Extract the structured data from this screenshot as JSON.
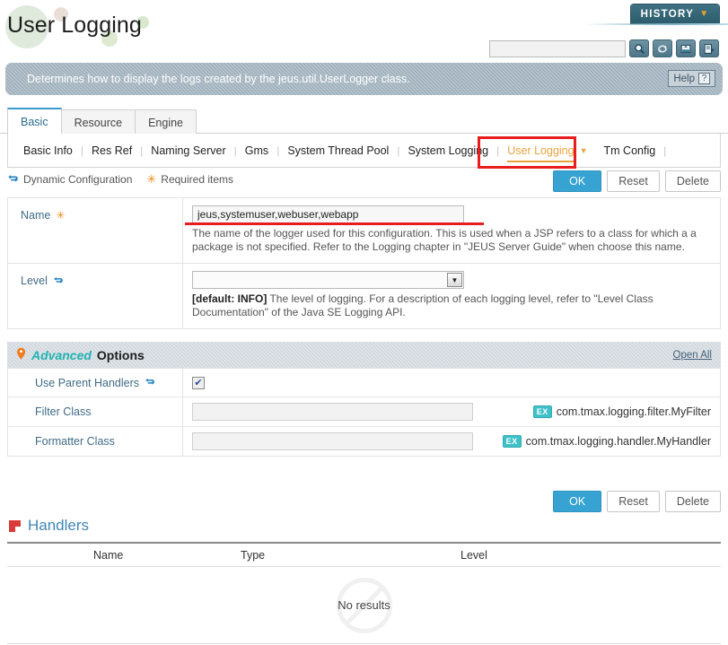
{
  "header": {
    "title": "User Logging",
    "history_label": "HISTORY",
    "history_chevron": "▼",
    "search_value": "",
    "search_placeholder": "",
    "tools": [
      {
        "name": "search-icon",
        "glyph": "🔍"
      },
      {
        "name": "refresh-icon",
        "glyph": "⟳"
      },
      {
        "name": "xml-export-icon",
        "glyph": "XML"
      },
      {
        "name": "download-icon",
        "glyph": "⬇"
      }
    ]
  },
  "banner": {
    "text": "Determines how to display the logs created by the jeus.util.UserLogger class.",
    "help_label": "Help",
    "help_glyph": "?"
  },
  "tabs": [
    {
      "label": "Basic",
      "active": true
    },
    {
      "label": "Resource",
      "active": false
    },
    {
      "label": "Engine",
      "active": false
    }
  ],
  "subtabs": [
    {
      "label": "Basic Info",
      "active": false
    },
    {
      "label": "Res Ref",
      "active": false
    },
    {
      "label": "Naming Server",
      "active": false
    },
    {
      "label": "Gms",
      "active": false
    },
    {
      "label": "System Thread Pool",
      "active": false
    },
    {
      "label": "System Logging",
      "active": false
    },
    {
      "label": "User Logging",
      "active": true
    },
    {
      "label": "Tm Config",
      "active": false
    }
  ],
  "legend": {
    "dynamic_label": "Dynamic Configuration",
    "required_label": "Required items",
    "dynamic_glyph": "↻",
    "required_glyph": "✳"
  },
  "actions": {
    "ok": "OK",
    "reset": "Reset",
    "delete": "Delete"
  },
  "form": {
    "name": {
      "label": "Name",
      "marker": "✳",
      "value": "jeus,systemuser,webuser,webapp",
      "description": "The name of the logger used for this configuration. This is used when a JSP refers to a class for which a a package is not specified. Refer to the Logging chapter in \"JEUS Server Guide\" when choose this name."
    },
    "level": {
      "label": "Level",
      "marker": "↻",
      "value": "",
      "default_tag": "[default: INFO]",
      "description": "The level of logging. For a description of each logging level, refer to \"Level Class Documentation\" of the Java SE Logging API."
    }
  },
  "advanced": {
    "title_italic": "Advanced",
    "title_rest": "Options",
    "bulb_glyph": "⬤",
    "open_all": "Open All",
    "rows": [
      {
        "label": "Use Parent Handlers",
        "marker": "↻",
        "control": "checkbox",
        "checked": true,
        "check_glyph": "✔",
        "value": "",
        "example_badge": "",
        "example": ""
      },
      {
        "label": "Filter Class",
        "marker": "",
        "control": "input",
        "value": "",
        "example_badge": "EX",
        "example": "com.tmax.logging.filter.MyFilter"
      },
      {
        "label": "Formatter Class",
        "marker": "",
        "control": "input",
        "value": "",
        "example_badge": "EX",
        "example": "com.tmax.logging.handler.MyHandler"
      }
    ]
  },
  "handlers": {
    "title": "Handlers",
    "columns": [
      "Name",
      "Type",
      "Level"
    ],
    "empty_text": "No results",
    "rows": []
  }
}
